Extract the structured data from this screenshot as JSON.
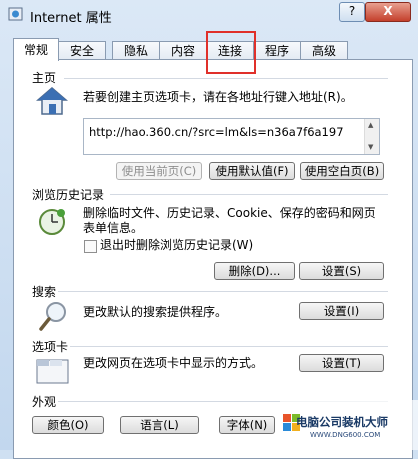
{
  "window": {
    "title": "Internet 属性",
    "help_label": "?",
    "close_label": "X"
  },
  "tabs": [
    {
      "label": "常规"
    },
    {
      "label": "安全"
    },
    {
      "label": "隐私"
    },
    {
      "label": "内容"
    },
    {
      "label": "连接"
    },
    {
      "label": "程序"
    },
    {
      "label": "高级"
    }
  ],
  "home": {
    "title": "主页",
    "desc": "若要创建主页选项卡，请在各地址行键入地址(R)。",
    "url": "http://hao.360.cn/?src=lm&ls=n36a7f6a197",
    "use_current": "使用当前页(C)",
    "use_default": "使用默认值(F)",
    "use_blank": "使用空白页(B)"
  },
  "history": {
    "title": "浏览历史记录",
    "desc_line1": "删除临时文件、历史记录、Cookie、保存的密码和网页",
    "desc_line2": "表单信息。",
    "checkbox_label": "退出时删除浏览历史记录(W)",
    "delete": "删除(D)...",
    "settings": "设置(S)"
  },
  "search": {
    "title": "搜索",
    "desc": "更改默认的搜索提供程序。",
    "settings": "设置(I)"
  },
  "tabsec": {
    "title": "选项卡",
    "desc": "更改网页在选项卡中显示的方式。",
    "settings": "设置(T)"
  },
  "appearance": {
    "title": "外观",
    "colors": "颜色(O)",
    "languages": "语言(L)",
    "fonts": "字体(N)"
  },
  "watermark": {
    "text": "电脑公司装机大师",
    "small": "WWW.DNG600.COM"
  }
}
